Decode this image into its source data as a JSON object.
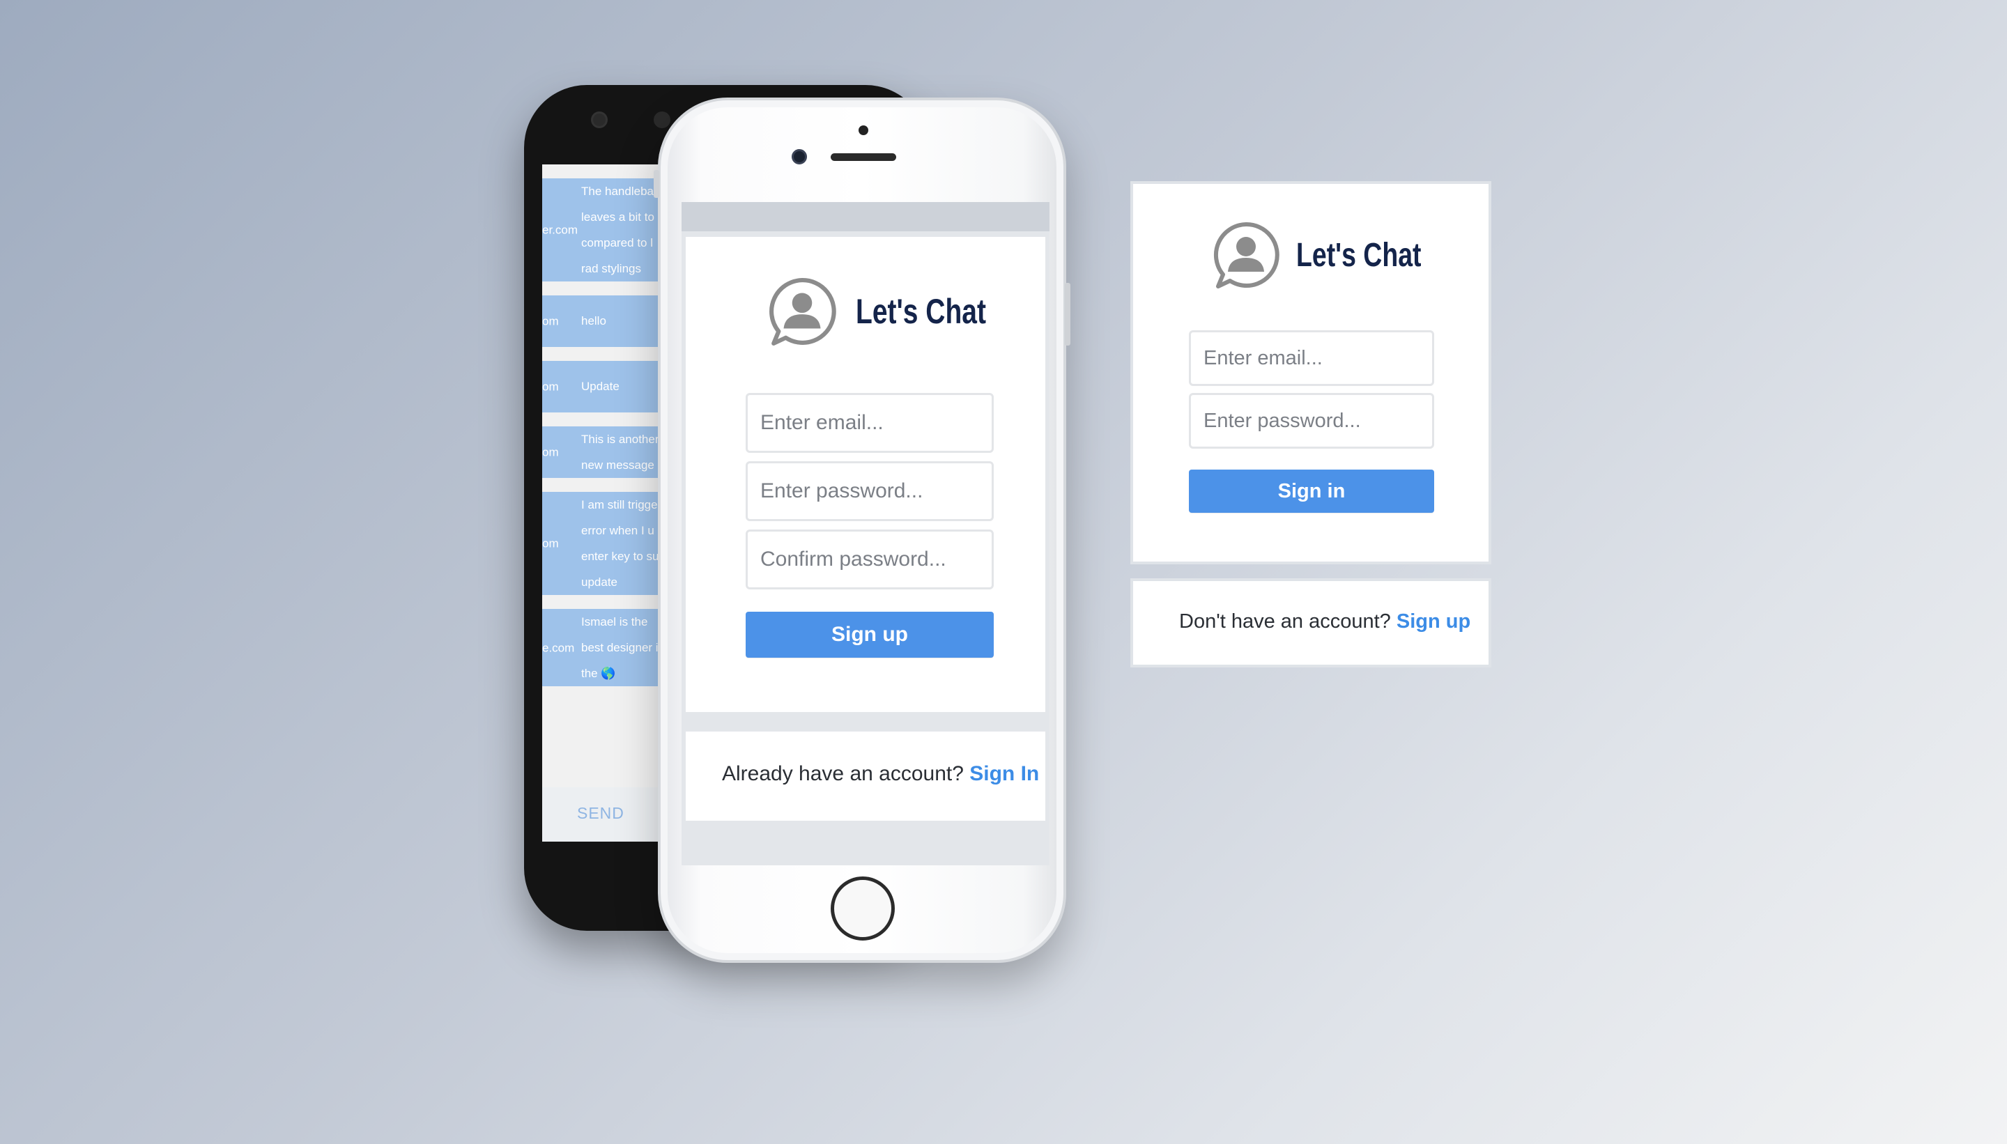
{
  "app": {
    "name": "Let's Chat",
    "logo_icon": "chat-user-icon"
  },
  "chat_screen": {
    "messages": [
      {
        "sender": "er.com",
        "text": "The handlebar leaves a bit to compared to l rad stylings"
      },
      {
        "sender": "om",
        "text": "hello"
      },
      {
        "sender": "om",
        "text": "Update"
      },
      {
        "sender": "om",
        "text": "This is another new message"
      },
      {
        "sender": "om",
        "text": "I am still trigge error when I u enter key to su update"
      },
      {
        "sender": "e.com",
        "text": "Ismael is the best designer i the 🌎"
      }
    ],
    "send_label": "SEND"
  },
  "signup_mobile": {
    "email_placeholder": "Enter email...",
    "password_placeholder": "Enter password...",
    "confirm_placeholder": "Confirm password...",
    "button_label": "Sign up",
    "footer_prompt": "Already have an account?",
    "footer_link": "Sign In"
  },
  "signin_desktop": {
    "email_placeholder": "Enter email...",
    "password_placeholder": "Enter password...",
    "button_label": "Sign in",
    "footer_prompt": "Don't have an account?",
    "footer_link": "Sign up"
  },
  "colors": {
    "primary": "#4c92e8",
    "link": "#3c8ce6",
    "logo_text": "#14244a",
    "message_bubble": "#9ec2ea",
    "icon_gray": "#8c8c8c"
  }
}
